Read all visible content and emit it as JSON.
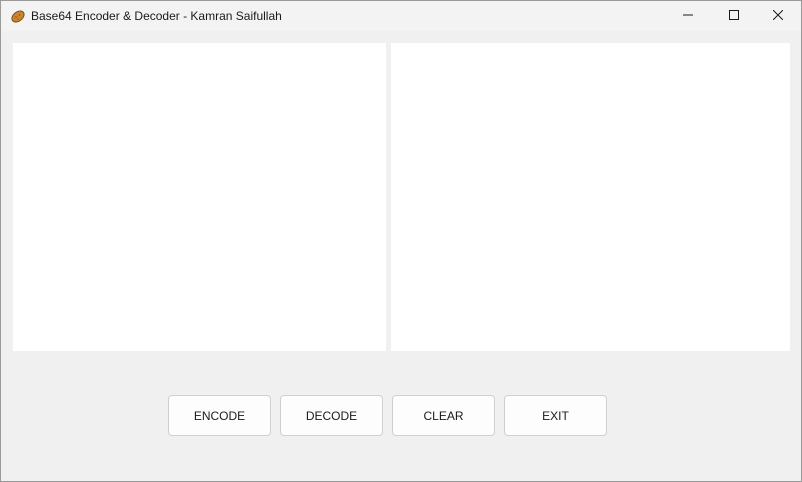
{
  "window": {
    "title": "Base64 Encoder & Decoder - Kamran Saifullah",
    "app_icon": "potato-app-icon",
    "controls": {
      "minimize_icon": "minimize-icon",
      "maximize_icon": "maximize-icon",
      "close_icon": "close-icon"
    }
  },
  "panes": {
    "input_value": "",
    "output_value": ""
  },
  "buttons": {
    "encode_label": "ENCODE",
    "decode_label": "DECODE",
    "clear_label": "CLEAR",
    "exit_label": "EXIT"
  },
  "colors": {
    "window_background": "#f0f0f0",
    "pane_background": "#ffffff",
    "button_background": "#fdfdfd"
  }
}
